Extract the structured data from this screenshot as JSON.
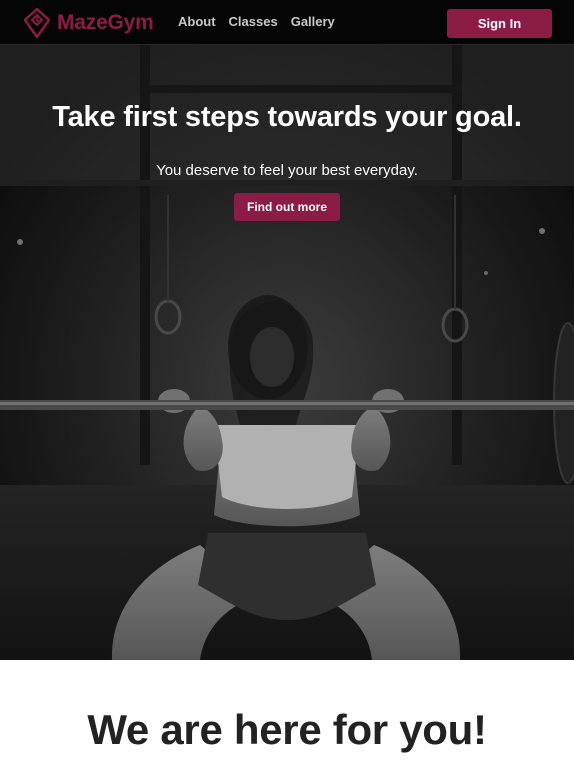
{
  "brand": {
    "name": "MazeGym",
    "logo_icon": "maze-pin-logo-icon",
    "color": "#8a1c45"
  },
  "nav": {
    "links": [
      {
        "label": "About"
      },
      {
        "label": "Classes"
      },
      {
        "label": "Gallery"
      }
    ],
    "signin_label": "Sign In"
  },
  "hero": {
    "title": "Take first steps towards your goal.",
    "subtitle": "You deserve to feel your best everyday.",
    "cta_label": "Find out more",
    "image": "woman-barbell-squat-photo-grayscale"
  },
  "section": {
    "title": "We are here for you!"
  },
  "colors": {
    "accent": "#8a1c45",
    "navbar_bg": "#050505",
    "nav_text": "#c9c9c9"
  }
}
